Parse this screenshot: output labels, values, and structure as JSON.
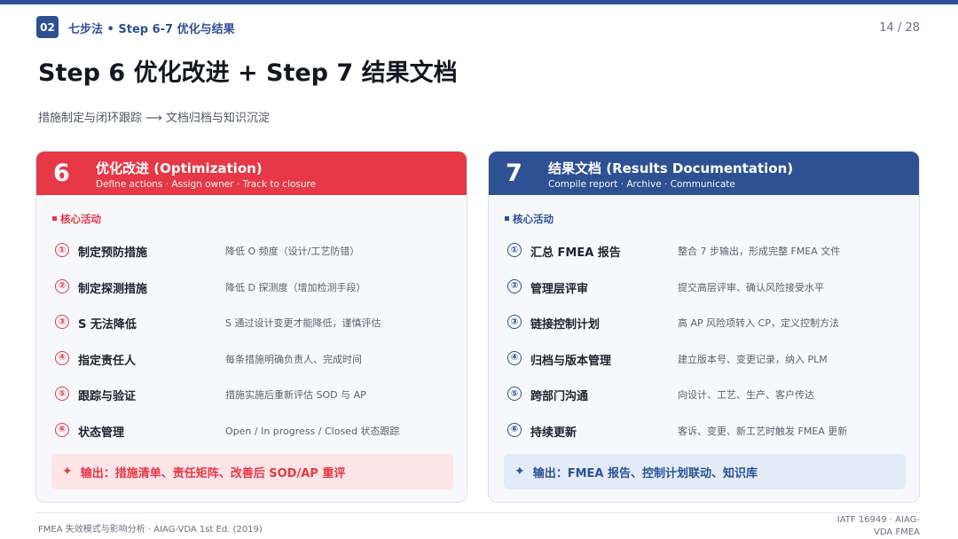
{
  "header": {
    "section_number": "02",
    "breadcrumb": "七步法 • Step 6-7 优化与结果",
    "page_indicator": "14 / 28"
  },
  "title": "Step 6 优化改进 + Step 7 结果文档",
  "subtitle": "措施制定与闭环跟踪 ⟶ 文档归档与知识沉淀",
  "cards": [
    {
      "step": "6",
      "title": "优化改进 (Optimization)",
      "desc": "Define actions · Assign owner · Track to closure",
      "section_label": "核心活动",
      "accent_color": "#e63846",
      "items": [
        {
          "num": "①",
          "label": "制定预防措施",
          "desc": "降低 O 频度（设计/工艺防错）"
        },
        {
          "num": "②",
          "label": "制定探测措施",
          "desc": "降低 D 探测度（增加检测手段）"
        },
        {
          "num": "③",
          "label": "S 无法降低",
          "desc": "S 通过设计变更才能降低，谨慎评估"
        },
        {
          "num": "④",
          "label": "指定责任人",
          "desc": "每条措施明确负责人、完成时间"
        },
        {
          "num": "⑤",
          "label": "跟踪与验证",
          "desc": "措施实施后重新评估 SOD 与 AP"
        },
        {
          "num": "⑥",
          "label": "状态管理",
          "desc": "Open / In progress / Closed 状态跟踪"
        }
      ],
      "output": "输出：措施清单、责任矩阵、改善后 SOD/AP 重评"
    },
    {
      "step": "7",
      "title": "结果文档 (Results Documentation)",
      "desc": "Compile report · Archive · Communicate",
      "section_label": "核心活动",
      "accent_color": "#2d5193",
      "items": [
        {
          "num": "①",
          "label": "汇总 FMEA 报告",
          "desc": "整合 7 步输出，形成完整 FMEA 文件"
        },
        {
          "num": "②",
          "label": "管理层评审",
          "desc": "提交高层评审、确认风险接受水平"
        },
        {
          "num": "③",
          "label": "链接控制计划",
          "desc": "高 AP 风险项转入 CP，定义控制方法"
        },
        {
          "num": "④",
          "label": "归档与版本管理",
          "desc": "建立版本号、变更记录，纳入 PLM"
        },
        {
          "num": "⑤",
          "label": "跨部门沟通",
          "desc": "向设计、工艺、生产、客户传达"
        },
        {
          "num": "⑥",
          "label": "持续更新",
          "desc": "客诉、变更、新工艺时触发 FMEA 更新"
        }
      ],
      "output": "输出：FMEA 报告、控制计划联动、知识库"
    }
  ],
  "footer": {
    "left": "FMEA 失效模式与影响分析 · AIAG-VDA 1st Ed. (2019)",
    "right": "IATF 16949 · AIAG-VDA FMEA"
  }
}
